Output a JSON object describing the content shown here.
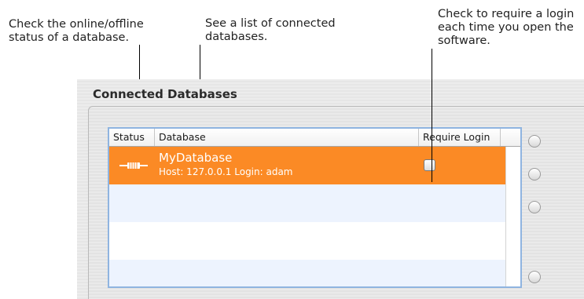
{
  "callouts": {
    "status_note": "Check the online/offline\nstatus of a database.",
    "list_note": "See a list of connected\ndatabases.",
    "login_note": "Check to require a login\neach time you open the\nsoftware."
  },
  "panel": {
    "title": "Connected Databases"
  },
  "table": {
    "columns": [
      "Status",
      "Database",
      "Require Login"
    ],
    "rows": [
      {
        "status_icon": "plug-connected-icon",
        "name": "MyDatabase",
        "info": "Host: 127.0.0.1 Login: adam",
        "require_login": false,
        "selected": true
      }
    ]
  },
  "colors": {
    "selection": "#fb8a25",
    "alt_row": "#edf3fe",
    "focus_border": "#8fb4e0"
  }
}
